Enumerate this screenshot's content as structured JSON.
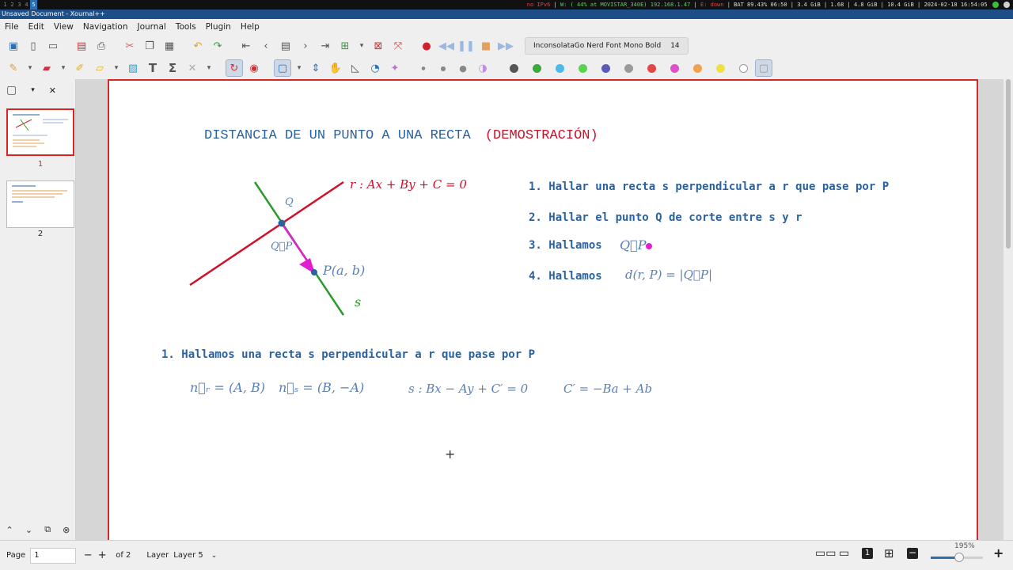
{
  "topbar": {
    "workspaces": [
      "1",
      "2",
      "3",
      "4",
      "5"
    ],
    "active_workspace": "5",
    "net_warn": "no IPv6",
    "wifi": "W: ( 44% at MOVISTAR_340E) 192.168.1.47",
    "eth": "E: down",
    "battery": "BAT 89.43% 06:50",
    "mem": "3.4 GiB",
    "load": "1.68",
    "mem2": "4.8 GiB",
    "disk": "10.4 GiB",
    "datetime": "2024-02-18 16:54:05"
  },
  "window": {
    "title": "Unsaved Document - Xournal++"
  },
  "menu": [
    "File",
    "Edit",
    "View",
    "Navigation",
    "Journal",
    "Tools",
    "Plugin",
    "Help"
  ],
  "toolbar": {
    "font_name": "InconsolataGo Nerd Font Mono Bold",
    "font_size": "14"
  },
  "pen_colors": [
    "#555555",
    "#3aaa3a",
    "#4fb8e8",
    "#56d64a",
    "#5c5ab8",
    "#9a9a9a",
    "#e04848",
    "#e050c8",
    "#f0a050",
    "#f0e040",
    "#ffffff"
  ],
  "sidebar": {
    "pages": [
      {
        "num": "1"
      },
      {
        "num": "2"
      }
    ]
  },
  "page": {
    "title_main": "DISTANCIA DE UN PUNTO A UNA RECTA",
    "title_paren": "(DEMOSTRACIÓN)",
    "diagram": {
      "label_r": "r : Ax + By + C = 0",
      "label_q": "Q",
      "label_qp": "Q⃗P",
      "label_p": "P(a, b)",
      "label_s": "s"
    },
    "steps": [
      {
        "text": "1. Hallar una recta s perpendicular a r que pase por P",
        "math": ""
      },
      {
        "text": "2. Hallar el punto Q de corte entre s y r",
        "math": ""
      },
      {
        "text": "3. Hallamos",
        "math": "Q⃗P"
      },
      {
        "text": "4. Hallamos",
        "math": "d(r, P) = |Q⃗P|"
      }
    ],
    "section1": "1. Hallamos una recta s perpendicular a r que pase por P",
    "eq1": "n⃗ᵣ = (A, B)",
    "eq2": "n⃗ₛ = (B, −A)",
    "eq3": "s : Bx − Ay + C′ = 0",
    "eq4": "C′ = −Ba + Ab"
  },
  "status": {
    "page_label": "Page",
    "page_value": "1",
    "page_of": "of 2",
    "layer_label": "Layer",
    "layer_value": "Layer 5",
    "zoom": "195%"
  }
}
